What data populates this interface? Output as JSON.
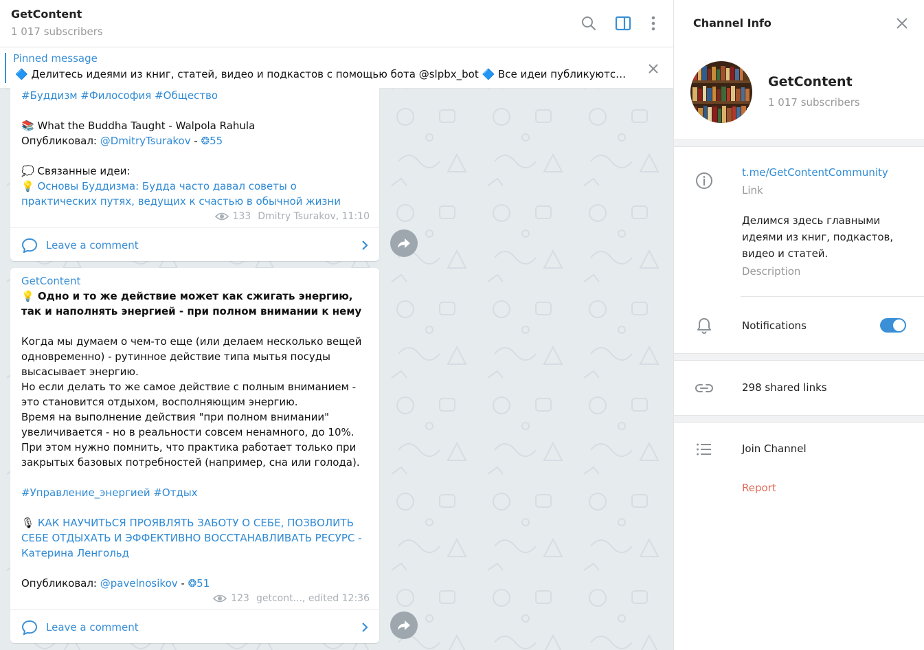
{
  "chat": {
    "title": "GetContent",
    "subscribers": "1 017 subscribers",
    "icons": [
      "search-icon",
      "sidebar-toggle-icon",
      "more-vertical-icon"
    ],
    "pinned": {
      "label": "Pinned message",
      "text": "🔷 Делитесь идеями из книг, статей, видео и подкастов с помощью бота @slpbx_bot 🔷 Все идеи публикуются в ..."
    },
    "messages": [
      {
        "hashtags": "#Буддизм #Философия #Общество",
        "book_icon": "📚",
        "book": "What the Buddha Taught - Walpola Rahula",
        "published_label": "Опубликовал: ",
        "author_link": "@DmitryTsurakov",
        "dash": " - ",
        "score": "❂55",
        "related_icon": "💭",
        "related_label": "Связанные идеи:",
        "idea_icon": "💡",
        "related_link": "Основы Буддизма: Будда часто давал советы о практических путях, ведущих к счастью в обычной жизни",
        "views": "133",
        "signature": "Dmitry Tsurakov, 11:10",
        "comment_label": "Leave a comment"
      },
      {
        "sender": "GetContent",
        "bulb_icon": "💡",
        "headline": "Одно и то же действие может как сжигать энергию, так и наполнять энергией - при полном внимании к нему",
        "body": "Когда мы думаем о чем-то еще (или делаем несколько вещей одновременно) - рутинное действие типа мытья посуды высасывает энергию.\nНо если делать то же самое действие с полным вниманием - это становится отдыхом, восполняющим энергию.\nВремя на выполнение действия \"при полном внимании\" увеличивается - но в реальности совсем ненамного, до 10%.\nПри этом нужно помнить, что практика работает только при закрытых базовых потребностей (например, сна или голода).",
        "hashtags": "#Управление_энергией #Отдых",
        "mic_icon": "🎙",
        "source_link": "КАК НАУЧИТЬСЯ ПРОЯВЛЯТЬ ЗАБОТУ О СЕБЕ, ПОЗВОЛИТЬ СЕБЕ ОТДЫХАТЬ И ЭФФЕКТИВНО ВОССТАНАВЛИВАТЬ РЕСУРС - Катерина Ленгольд",
        "published_label": "Опубликовал: ",
        "author_link": "@pavelnosikov",
        "dash": " - ",
        "score": "❂51",
        "views": "123",
        "signature": "getcont..., edited 12:36",
        "comment_label": "Leave a comment"
      }
    ]
  },
  "info": {
    "title": "Channel Info",
    "name": "GetContent",
    "subscribers": "1 017 subscribers",
    "link": "t.me/GetContentCommunity",
    "link_label": "Link",
    "description": "Делимся здесь главными идеями из книг, подкастов, видео и статей.",
    "description_label": "Description",
    "notifications_label": "Notifications",
    "notifications_on": true,
    "shared_links": "298 shared links",
    "join": "Join Channel",
    "report": "Report"
  },
  "colors": {
    "accent": "#3a8fd6",
    "link": "#2f8ad4",
    "report": "#e06c5a",
    "chat_bg": "#e6ebee"
  }
}
